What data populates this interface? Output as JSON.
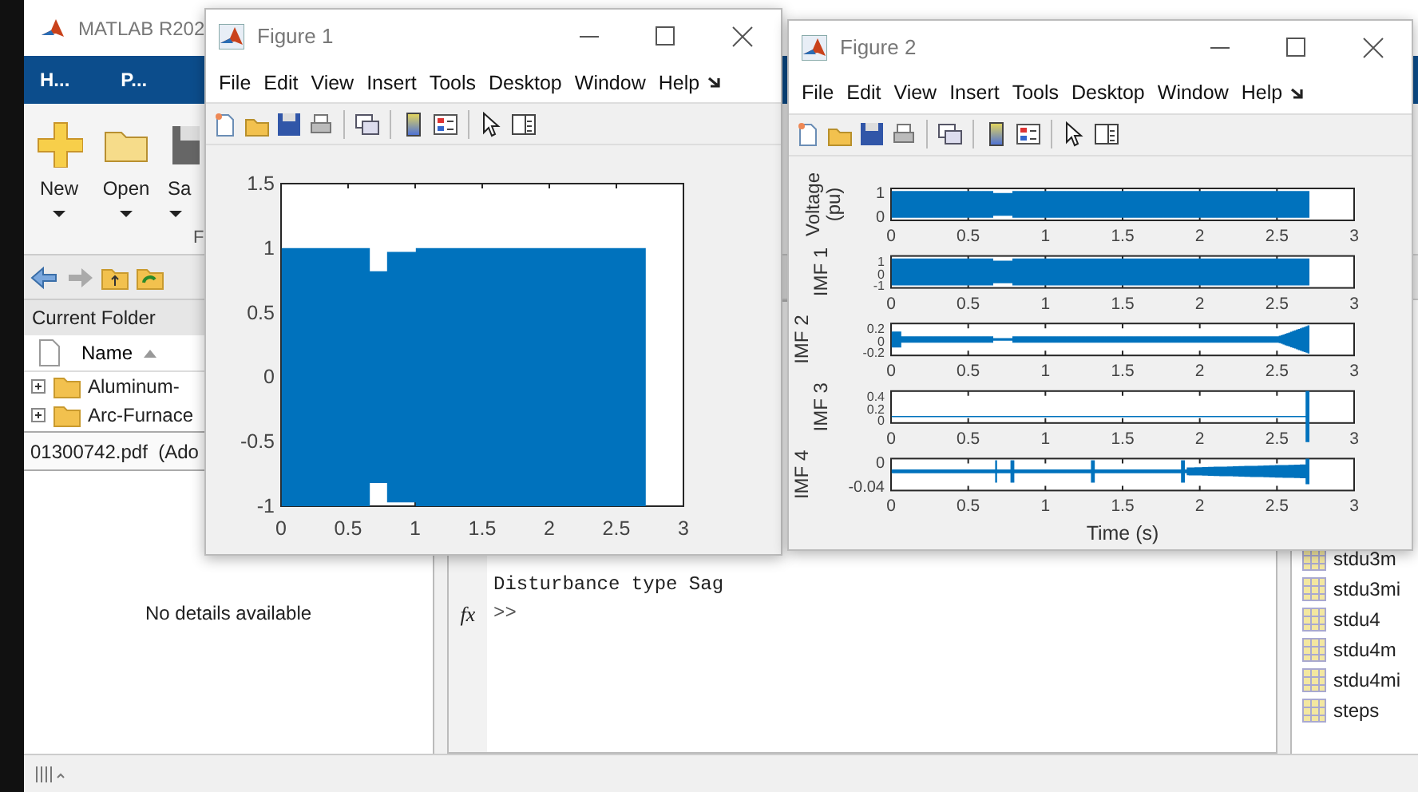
{
  "main_window": {
    "title": "MATLAB R202",
    "ribbon_tabs": [
      {
        "label": "H..."
      },
      {
        "label": "P..."
      }
    ],
    "toolstrip": {
      "buttons": [
        {
          "label": "New",
          "kind": "new"
        },
        {
          "label": "Open",
          "kind": "open"
        },
        {
          "label": "Sa",
          "kind": "save"
        }
      ],
      "section_label": "F"
    },
    "current_folder": {
      "title": "Current Folder",
      "column": "Name",
      "items": [
        {
          "name": "Aluminum-"
        },
        {
          "name": "Arc-Furnace"
        }
      ],
      "details_file": "01300742.pdf  (Ado",
      "details_message": "No details available"
    },
    "command_window": {
      "lines": [
        "Disturbance type Sag"
      ],
      "fx": "fx",
      "prompt": ">>"
    },
    "workspace": {
      "items": [
        "stdu3m",
        "stdu3mi",
        "stdu4",
        "stdu4m",
        "stdu4mi",
        "steps"
      ]
    }
  },
  "figures": [
    {
      "title": "Figure 1",
      "menus": [
        "File",
        "Edit",
        "View",
        "Insert",
        "Tools",
        "Desktop",
        "Window",
        "Help"
      ],
      "plots": [
        {
          "kind": "sag",
          "yticks": [
            "1.5",
            "1",
            "0.5",
            "0",
            "-0.5",
            "-1"
          ],
          "xticks": [
            "0",
            "0.5",
            "1",
            "1.5",
            "2",
            "2.5",
            "3"
          ]
        }
      ]
    },
    {
      "title": "Figure 2",
      "menus": [
        "File",
        "Edit",
        "View",
        "Insert",
        "Tools",
        "Desktop",
        "Window",
        "Help"
      ],
      "xlabel": "Time (s)",
      "plots": [
        {
          "kind": "dense",
          "ylabel": [
            "Voltage",
            "(pu)"
          ],
          "yticks": [
            "1",
            "0"
          ],
          "xticks": [
            "0",
            "0.5",
            "1",
            "1.5",
            "2",
            "2.5",
            "3"
          ]
        },
        {
          "kind": "dense",
          "ylabel": [
            "IMF 1"
          ],
          "yticks": [
            "1",
            "0",
            "-1"
          ],
          "xticks": [
            "0",
            "0.5",
            "1",
            "1.5",
            "2",
            "2.5",
            "3"
          ]
        },
        {
          "kind": "narrow",
          "ylabel": [
            "IMF 2"
          ],
          "yticks": [
            "0.2",
            "0",
            "-0.2"
          ],
          "xticks": [
            "0",
            "0.5",
            "1",
            "1.5",
            "2",
            "2.5",
            "3"
          ]
        },
        {
          "kind": "flat",
          "ylabel": [
            "IMF 3"
          ],
          "yticks": [
            "0.4",
            "0.2",
            "0"
          ],
          "xticks": [
            "0",
            "0.5",
            "1",
            "1.5",
            "2",
            "2.5",
            "3"
          ]
        },
        {
          "kind": "burst",
          "ylabel": [
            "IMF 4"
          ],
          "yticks": [
            "0",
            "-0.04"
          ],
          "xticks": [
            "0",
            "0.5",
            "1",
            "1.5",
            "2",
            "2.5",
            "3"
          ]
        }
      ]
    }
  ]
}
